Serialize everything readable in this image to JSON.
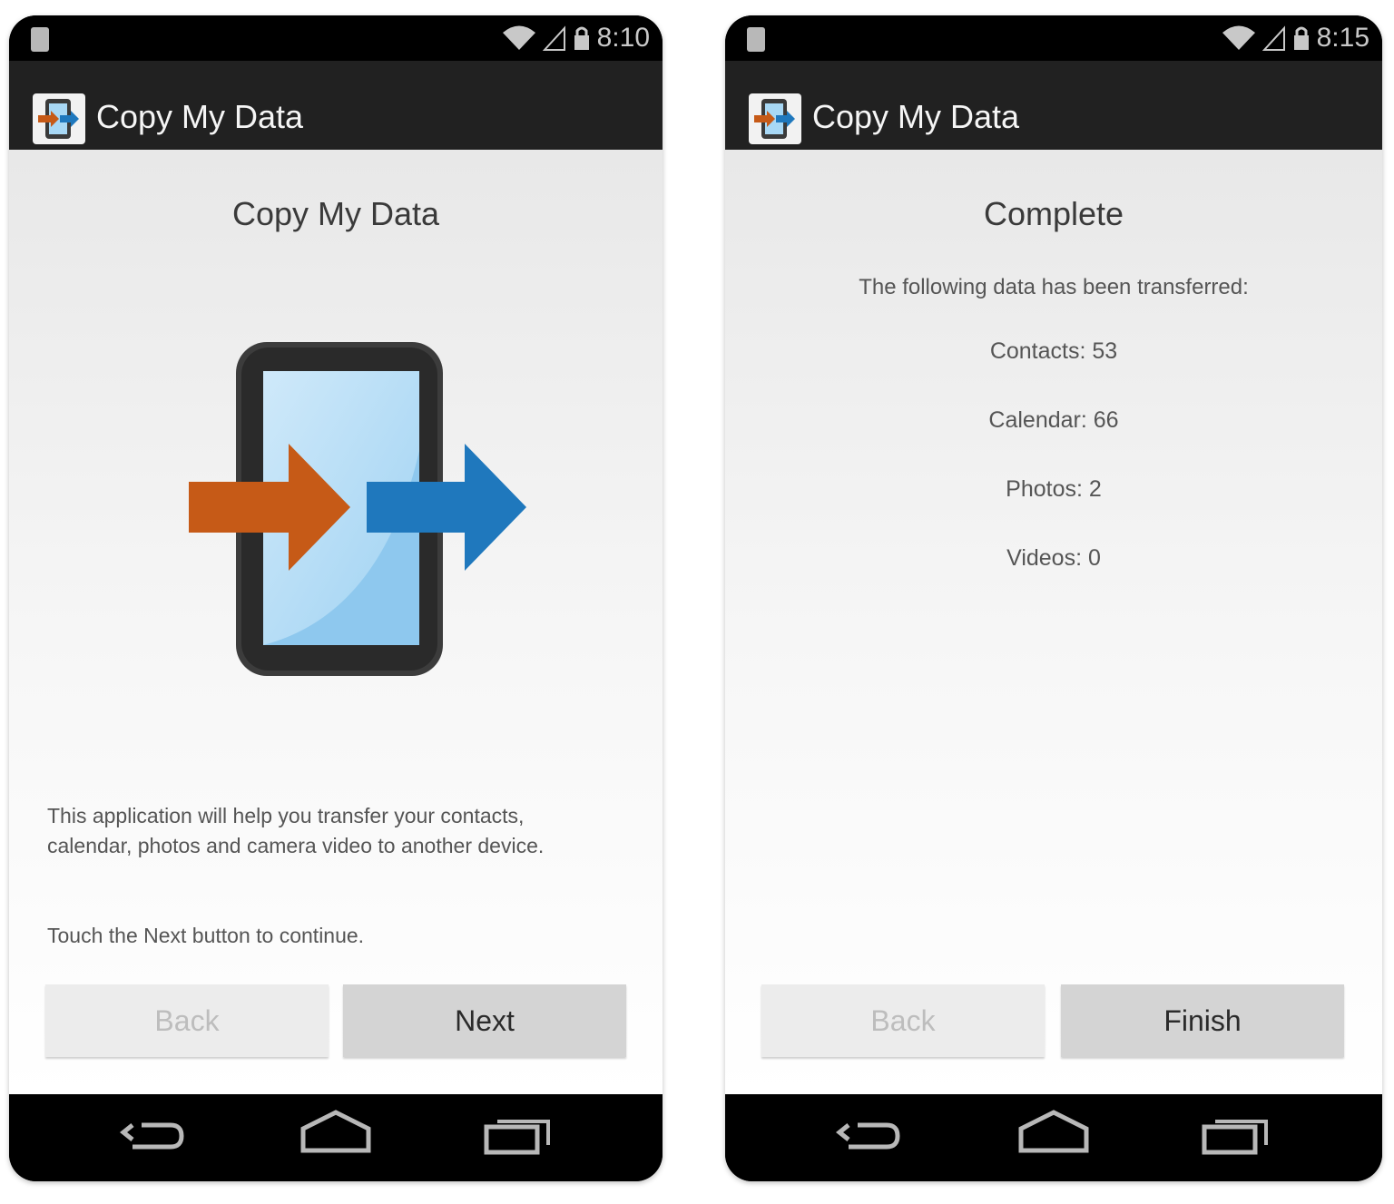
{
  "screens": [
    {
      "status_time": "8:10",
      "app_title": "Copy My Data",
      "heading": "Copy My Data",
      "description": "This application will help you transfer your contacts, calendar, photos and camera video to another device.",
      "instruction": "Touch the Next button to continue.",
      "back_label": "Back",
      "next_label": "Next"
    },
    {
      "status_time": "8:15",
      "app_title": "Copy My Data",
      "heading": "Complete",
      "summary_intro": "The following data has been transferred:",
      "items": [
        "Contacts: 53",
        "Calendar: 66",
        "Photos: 2",
        "Videos: 0"
      ],
      "back_label": "Back",
      "finish_label": "Finish"
    }
  ],
  "icons": [
    "battery-icon",
    "wifi-icon",
    "signal-icon",
    "lock-icon",
    "app-icon",
    "back-nav-icon",
    "home-nav-icon",
    "recents-nav-icon"
  ],
  "colors": {
    "orange_arrow": "#c65a17",
    "blue_arrow": "#1f78bd",
    "screen_blue": "#a8d8f5",
    "action_bar": "#212121"
  }
}
